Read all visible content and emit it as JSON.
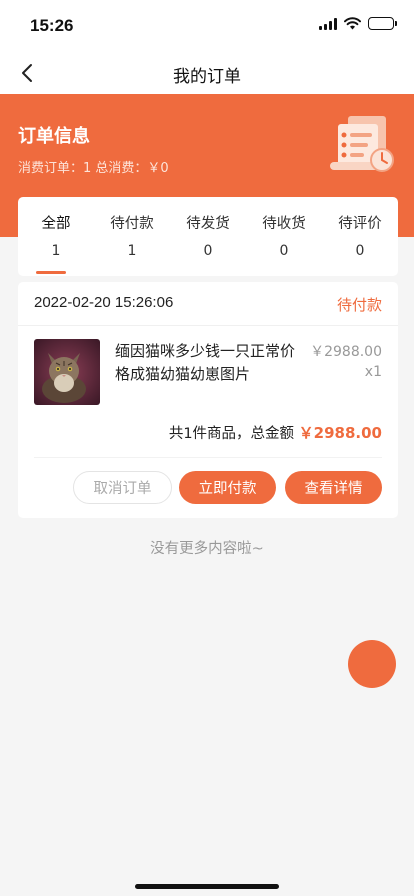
{
  "status_bar": {
    "time": "15:26",
    "icons": [
      "signal-icon",
      "wifi-icon",
      "battery-icon"
    ]
  },
  "nav": {
    "title": "我的订单",
    "back_icon": "chevron-left-icon"
  },
  "header": {
    "title": "订单信息",
    "summary": "消费订单：1 总消费：￥0",
    "illustration": "receipt-clock-icon"
  },
  "tabs": [
    {
      "label": "全部",
      "count": "1",
      "active": true
    },
    {
      "label": "待付款",
      "count": "1"
    },
    {
      "label": "待发货",
      "count": "0"
    },
    {
      "label": "待收货",
      "count": "0"
    },
    {
      "label": "待评价",
      "count": "0"
    }
  ],
  "order": {
    "time": "2022-02-20 15:26:06",
    "status": "待付款",
    "product": {
      "name": "缅因猫咪多少钱一只正常价格成猫幼猫幼崽图片",
      "price": "￥2988.00",
      "qty": "x1"
    },
    "total_prefix": "共1件商品，总金额",
    "total_amount": "￥2988.00",
    "buttons": {
      "cancel": "取消订单",
      "pay": "立即付款",
      "detail": "查看详情"
    }
  },
  "footer_text": "没有更多内容啦~",
  "colors": {
    "accent": "#ef6b3e",
    "background": "#f5f5f5"
  }
}
